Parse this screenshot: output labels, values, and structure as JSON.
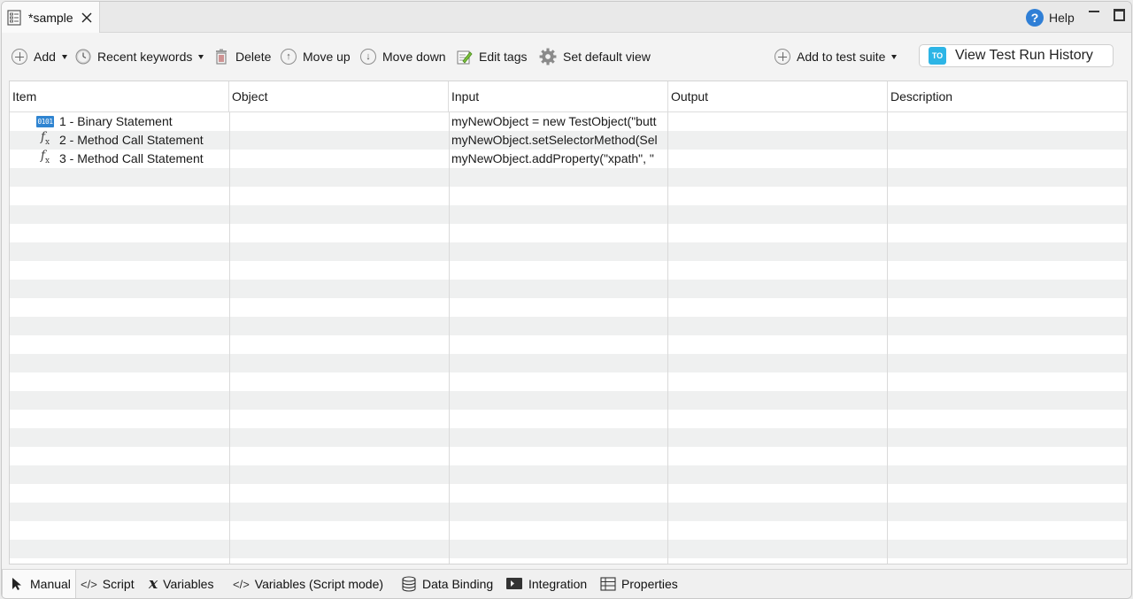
{
  "editor_tab": {
    "title": "*sample"
  },
  "help": {
    "label": "Help"
  },
  "toolbar": {
    "add": "Add",
    "recent_keywords": "Recent keywords",
    "delete": "Delete",
    "move_up": "Move up",
    "move_down": "Move down",
    "edit_tags": "Edit tags",
    "set_default_view": "Set default view",
    "add_to_test_suite": "Add to test suite",
    "view_test_run_history": "View Test Run History"
  },
  "table": {
    "columns": [
      "Item",
      "Object",
      "Input",
      "Output",
      "Description"
    ],
    "rows": [
      {
        "icon": "binary-icon",
        "item": "1 - Binary Statement",
        "object": "",
        "input": "myNewObject = new TestObject(\"butt",
        "output": "",
        "description": ""
      },
      {
        "icon": "function-icon",
        "item": "2 - Method Call Statement",
        "object": "",
        "input": "myNewObject.setSelectorMethod(Sel",
        "output": "",
        "description": ""
      },
      {
        "icon": "function-icon",
        "item": "3 - Method Call Statement",
        "object": "",
        "input": "myNewObject.addProperty(\"xpath\", \"",
        "output": "",
        "description": ""
      }
    ]
  },
  "bottom_tabs": [
    {
      "label": "Manual",
      "icon": "cursor-icon",
      "active": true
    },
    {
      "label": "Script",
      "icon": "code-icon",
      "active": false
    },
    {
      "label": "Variables",
      "icon": "variable-icon",
      "active": false
    },
    {
      "label": "Variables (Script mode)",
      "icon": "code-icon",
      "active": false
    },
    {
      "label": "Data Binding",
      "icon": "database-icon",
      "active": false
    },
    {
      "label": "Integration",
      "icon": "integration-icon",
      "active": false
    },
    {
      "label": "Properties",
      "icon": "table-icon",
      "active": false
    }
  ],
  "colors": {
    "accent_blue": "#2f7fd6",
    "stripe": "#eff0f0",
    "katalon_logo": "#2db5e6"
  }
}
